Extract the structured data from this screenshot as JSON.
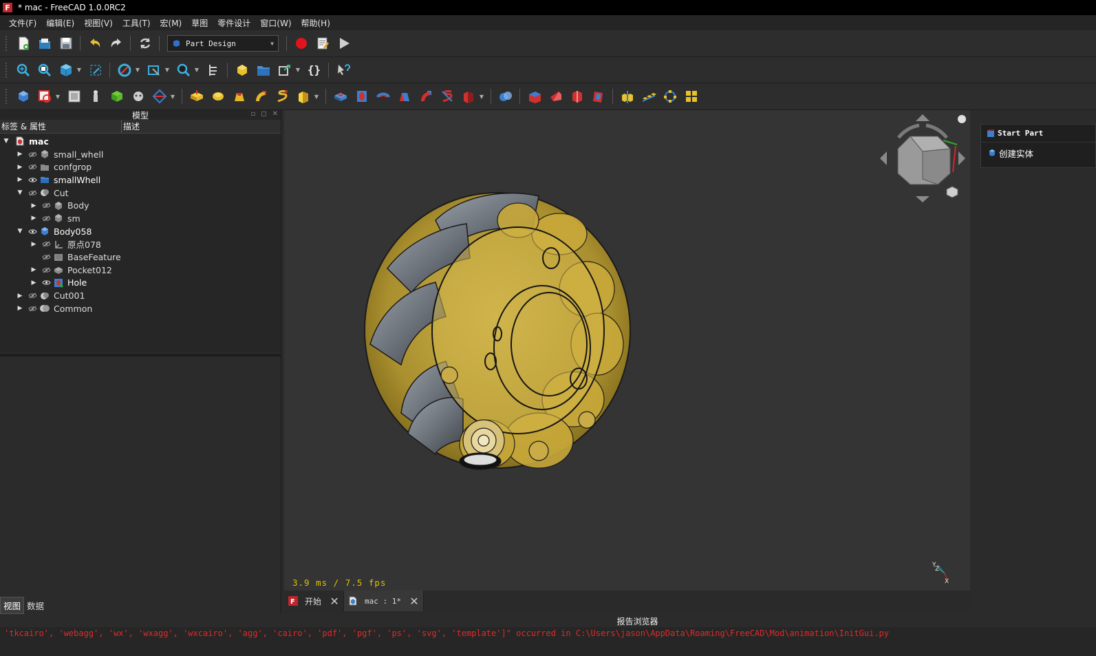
{
  "window": {
    "title": "* mac - FreeCAD 1.0.0RC2",
    "app_icon": "F"
  },
  "menu": [
    "文件(F)",
    "编辑(E)",
    "视图(V)",
    "工具(T)",
    "宏(M)",
    "草图",
    "零件设计",
    "窗口(W)",
    "帮助(H)"
  ],
  "workbench": {
    "selected": "Part Design"
  },
  "toolbar3": {
    "curly": "{}"
  },
  "model_panel": {
    "title": "模型",
    "col_label": "标签 & 属性",
    "col_desc": "描述",
    "tree": [
      {
        "label": "mac",
        "level": 0,
        "arrow": "▼",
        "icon": "document-icon",
        "style": "bold"
      },
      {
        "label": "small_whell",
        "level": 1,
        "arrow": "▶",
        "icon": "body-icon",
        "eye": "hidden"
      },
      {
        "label": "confgrop",
        "level": 1,
        "arrow": "▶",
        "icon": "folder-icon",
        "eye": "hidden"
      },
      {
        "label": "smallWhell",
        "level": 1,
        "arrow": "▶",
        "icon": "folder-blue-icon",
        "eye": "visible",
        "style": "bright"
      },
      {
        "label": "Cut",
        "level": 1,
        "arrow": "▼",
        "icon": "cut-icon",
        "eye": "hidden"
      },
      {
        "label": "Body",
        "level": 2,
        "arrow": "▶",
        "icon": "body-icon",
        "eye": "hidden"
      },
      {
        "label": "sm",
        "level": 2,
        "arrow": "▶",
        "icon": "body-icon",
        "eye": "hidden"
      },
      {
        "label": "Body058",
        "level": 1,
        "arrow": "▼",
        "icon": "body-blue-icon",
        "eye": "visible",
        "style": "bright"
      },
      {
        "label": "原点078",
        "level": 2,
        "arrow": "▶",
        "icon": "origin-icon",
        "eye": "hidden"
      },
      {
        "label": "BaseFeature",
        "level": 2,
        "arrow": "",
        "icon": "feature-icon",
        "eye": "hidden"
      },
      {
        "label": "Pocket012",
        "level": 2,
        "arrow": "▶",
        "icon": "pocket-icon",
        "eye": "hidden"
      },
      {
        "label": "Hole",
        "level": 2,
        "arrow": "▶",
        "icon": "hole-icon",
        "eye": "visible",
        "style": "bright"
      },
      {
        "label": "Cut001",
        "level": 1,
        "arrow": "▶",
        "icon": "cut-icon",
        "eye": "hidden"
      },
      {
        "label": "Common",
        "level": 1,
        "arrow": "▶",
        "icon": "common-icon",
        "eye": "hidden"
      }
    ],
    "tabs": [
      "视图",
      "数据"
    ]
  },
  "view3d": {
    "fps": "3.9 ms / 7.5 fps"
  },
  "doc_tabs": [
    {
      "label": "开始",
      "icon": "freecad-icon"
    },
    {
      "label": "mac : 1*",
      "icon": "document-icon"
    }
  ],
  "task_panel": {
    "header": "Start Part",
    "item": "创建实体"
  },
  "report": {
    "title": "报告浏览器",
    "lines": [
      "'tkcairo', 'webagg', 'wx', 'wxagg', 'wxcairo', 'agg', 'cairo', 'pdf', 'pgf', 'ps', 'svg', 'template']\" occurred in C:\\Users\\jason\\AppData\\Roaming\\FreeCAD\\Mod\\animation\\InitGui.py"
    ]
  },
  "colors": {
    "accent_yellow": "#e2c100",
    "error_red": "#e02a2a",
    "model_gold": "#b89a2e"
  }
}
